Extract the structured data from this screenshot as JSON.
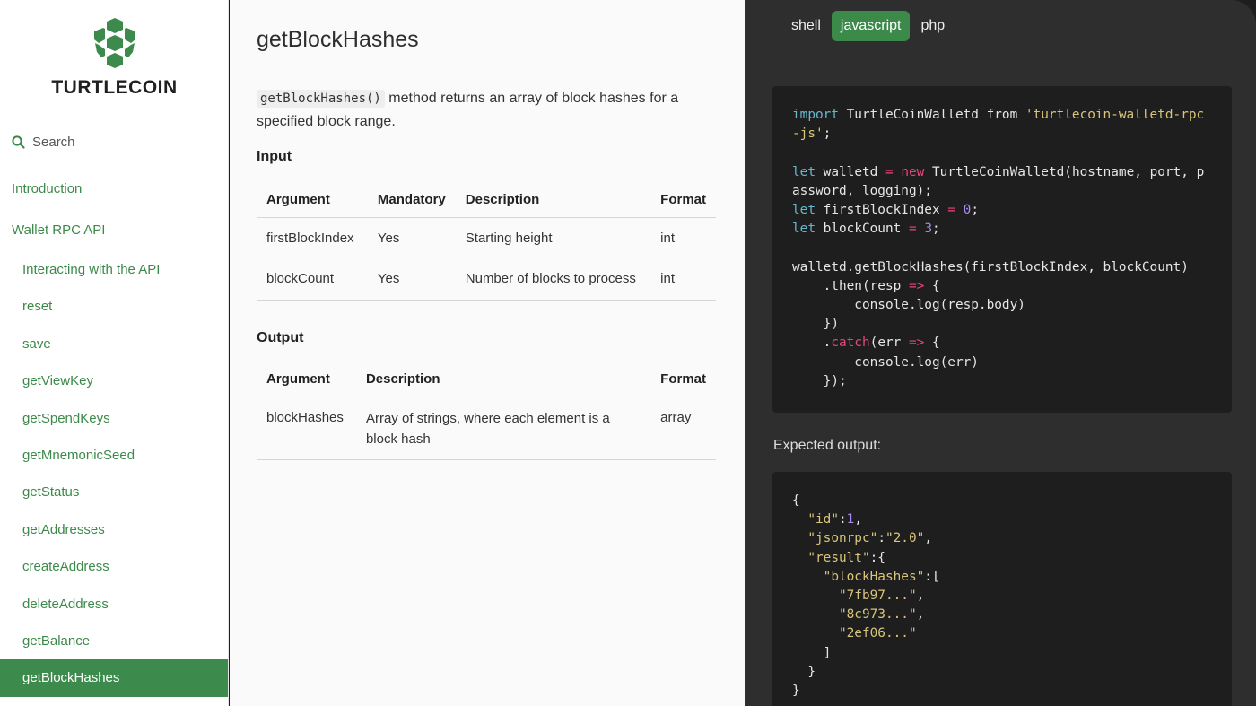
{
  "brand": {
    "name": "TURTLECOIN",
    "logo_icon": "turtle-shell-icon",
    "color": "#3d8b4c"
  },
  "search": {
    "label": "Search",
    "icon": "search-icon"
  },
  "nav": {
    "top": [
      {
        "label": "Introduction"
      },
      {
        "label": "Wallet RPC API"
      }
    ],
    "items": [
      {
        "label": "Interacting with the API"
      },
      {
        "label": "reset"
      },
      {
        "label": "save"
      },
      {
        "label": "getViewKey"
      },
      {
        "label": "getSpendKeys"
      },
      {
        "label": "getMnemonicSeed"
      },
      {
        "label": "getStatus"
      },
      {
        "label": "getAddresses"
      },
      {
        "label": "createAddress"
      },
      {
        "label": "deleteAddress"
      },
      {
        "label": "getBalance"
      },
      {
        "label": "getBlockHashes"
      }
    ]
  },
  "main": {
    "title": "getBlockHashes",
    "intro_code": "getBlockHashes()",
    "intro_text": " method returns an array of block hashes for a specified block range.",
    "input_title": "Input",
    "input_table": {
      "headers": [
        "Argument",
        "Mandatory",
        "Description",
        "Format"
      ],
      "rows": [
        [
          "firstBlockIndex",
          "Yes",
          "Starting height",
          "int"
        ],
        [
          "blockCount",
          "Yes",
          "Number of blocks to process",
          "int"
        ]
      ]
    },
    "output_title": "Output",
    "output_table": {
      "headers": [
        "Argument",
        "Description",
        "Format"
      ],
      "rows": [
        [
          "blockHashes",
          "Array of strings, where each element is a block hash",
          "array"
        ]
      ]
    }
  },
  "code_panel": {
    "tabs": [
      "shell",
      "javascript",
      "php"
    ],
    "active_tab": "javascript",
    "expected_label": "Expected output:"
  }
}
